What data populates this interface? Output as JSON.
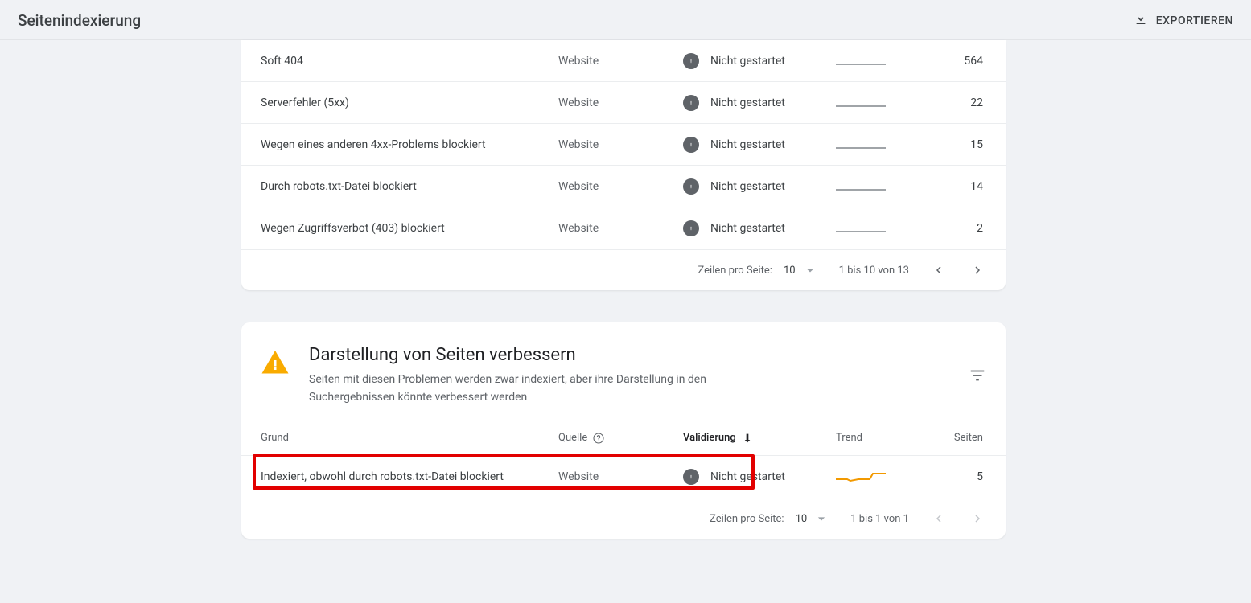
{
  "header": {
    "page_title": "Seitenindexierung",
    "export_label": "EXPORTIEREN"
  },
  "issues_card": {
    "rows": [
      {
        "reason": "Soft 404",
        "source": "Website",
        "validation": "Nicht gestartet",
        "pages": "564"
      },
      {
        "reason": "Serverfehler (5xx)",
        "source": "Website",
        "validation": "Nicht gestartet",
        "pages": "22"
      },
      {
        "reason": "Wegen eines anderen 4xx-Problems blockiert",
        "source": "Website",
        "validation": "Nicht gestartet",
        "pages": "15"
      },
      {
        "reason": "Durch robots.txt-Datei blockiert",
        "source": "Website",
        "validation": "Nicht gestartet",
        "pages": "14"
      },
      {
        "reason": "Wegen Zugriffsverbot (403) blockiert",
        "source": "Website",
        "validation": "Nicht gestartet",
        "pages": "2"
      }
    ],
    "pagination": {
      "rows_per_label": "Zeilen pro Seite:",
      "rows_per_value": "10",
      "range_text": "1 bis 10 von 13"
    }
  },
  "improve_card": {
    "title": "Darstellung von Seiten verbessern",
    "subtitle": "Seiten mit diesen Problemen werden zwar indexiert, aber ihre Darstellung in den Suchergebnissen könnte verbessert werden",
    "columns": {
      "reason": "Grund",
      "source": "Quelle",
      "validation": "Validierung",
      "trend": "Trend",
      "pages": "Seiten"
    },
    "rows": [
      {
        "reason": "Indexiert, obwohl durch robots.txt-Datei blockiert",
        "source": "Website",
        "validation": "Nicht gestartet",
        "pages": "5"
      }
    ],
    "pagination": {
      "rows_per_label": "Zeilen pro Seite:",
      "rows_per_value": "10",
      "range_text": "1 bis 1 von 1"
    }
  }
}
